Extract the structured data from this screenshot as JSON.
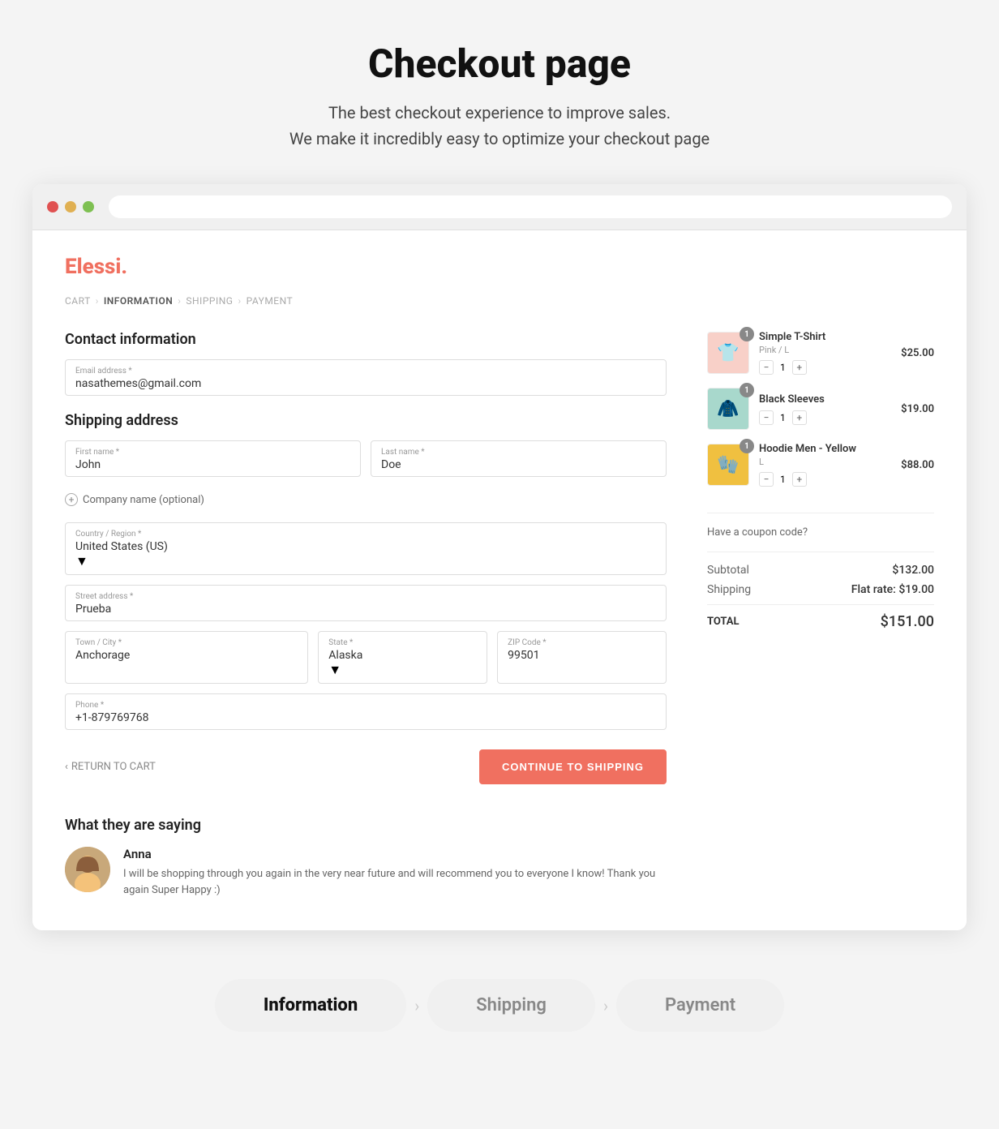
{
  "header": {
    "title": "Checkout page",
    "subtitle_line1": "The best checkout experience to improve sales.",
    "subtitle_line2": "We make it incredibly easy to optimize your checkout page"
  },
  "browser": {
    "dots": [
      "red",
      "yellow",
      "green"
    ]
  },
  "store": {
    "name": "Elessi",
    "dot": "."
  },
  "breadcrumb": {
    "cart": "CART",
    "information": "INFORMATION",
    "shipping": "SHIPPING",
    "payment": "PAYMENT"
  },
  "contact_section": {
    "title": "Contact information",
    "email_label": "Email address *",
    "email_value": "nasathemes@gmail.com"
  },
  "shipping_section": {
    "title": "Shipping address",
    "first_name_label": "First name *",
    "first_name_value": "John",
    "last_name_label": "Last name *",
    "last_name_value": "Doe",
    "company_label": "Company name (optional)",
    "country_label": "Country / Region *",
    "country_value": "United States (US)",
    "street_label": "Street address *",
    "street_value": "Prueba",
    "city_label": "Town / City *",
    "city_value": "Anchorage",
    "state_label": "State *",
    "state_value": "Alaska",
    "zip_label": "ZIP Code *",
    "zip_value": "99501",
    "phone_label": "Phone *",
    "phone_value": "+1-879769768"
  },
  "actions": {
    "return_label": "RETURN TO CART",
    "continue_label": "CONTINUE TO SHIPPING"
  },
  "testimonial": {
    "section_title": "What they are saying",
    "author": "Anna",
    "text": "I will be shopping through you again in the very near future and will recommend you to everyone I know! Thank you again Super Happy :)"
  },
  "order_items": [
    {
      "badge": "1",
      "name": "Simple T-Shirt",
      "variant": "Pink / L",
      "price": "$25.00",
      "qty": "1",
      "color": "tshirt"
    },
    {
      "badge": "1",
      "name": "Black Sleeves",
      "variant": "",
      "price": "$19.00",
      "qty": "1",
      "color": "sleeves"
    },
    {
      "badge": "1",
      "name": "Hoodie Men - Yellow",
      "variant": "L",
      "price": "$88.00",
      "qty": "1",
      "color": "hoodie"
    }
  ],
  "coupon": {
    "label": "Have a coupon code?"
  },
  "totals": {
    "subtotal_label": "Subtotal",
    "subtotal_value": "$132.00",
    "shipping_label": "Shipping",
    "shipping_value": "Flat rate: $19.00",
    "total_label": "TOTAL",
    "total_value": "$151.00"
  },
  "tabs": [
    {
      "label": "Information",
      "active": true
    },
    {
      "label": "Shipping",
      "active": false
    },
    {
      "label": "Payment",
      "active": false
    }
  ]
}
